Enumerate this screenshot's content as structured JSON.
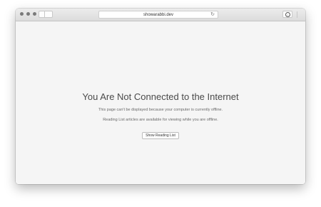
{
  "browser": {
    "address": "showarabbi.dev",
    "reload_icon": "reload-icon",
    "download_icon": "download-icon"
  },
  "page": {
    "title": "You Are Not Connected to the Internet",
    "message1": "This page can't be displayed because your computer is currently offline.",
    "message2": "Reading List articles are available for viewing while you are offline.",
    "button_label": "Show Reading List"
  },
  "colors": {
    "content_background": "#f5f5f5",
    "title_text": "#4a4a4a",
    "body_text": "#6a6a6a"
  }
}
